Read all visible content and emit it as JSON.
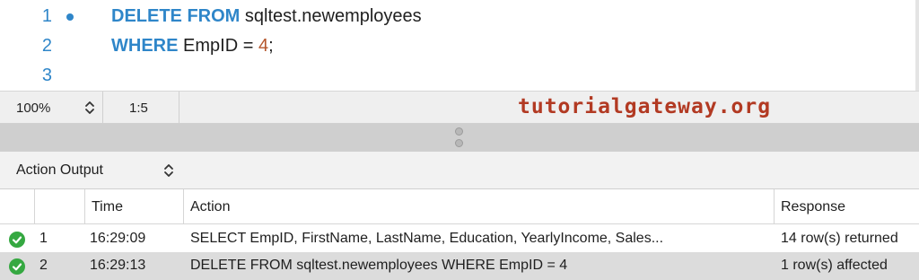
{
  "editor": {
    "lines": [
      {
        "number": "1",
        "keyword": "DELETE FROM",
        "rest": " sqltest.newemployees",
        "value": "",
        "tail": ""
      },
      {
        "number": "2",
        "keyword": "WHERE",
        "rest": " EmpID = ",
        "value": "4",
        "tail": ";"
      },
      {
        "number": "3",
        "keyword": "",
        "rest": "",
        "value": "",
        "tail": ""
      }
    ]
  },
  "statusbar": {
    "zoom": "100%",
    "cursor": "1:5",
    "watermark": "tutorialgateway.org"
  },
  "output": {
    "title": "Action Output",
    "columns": [
      "Time",
      "Action",
      "Response"
    ],
    "rows": [
      {
        "index": "1",
        "time": "16:29:09",
        "action": "SELECT EmpID, FirstName, LastName, Education,       YearlyIncome, Sales...",
        "response": "14 row(s) returned"
      },
      {
        "index": "2",
        "time": "16:29:13",
        "action": "DELETE FROM sqltest.newemployees WHERE EmpID = 4",
        "response": "1 row(s) affected"
      }
    ]
  },
  "colors": {
    "keyword": "#2f86c9",
    "number": "#b5562c",
    "watermark": "#b23a23",
    "success": "#35a841",
    "selected_row": "#dcdcdc"
  },
  "icons": [
    "breakpoint-dot-icon",
    "updown-chevron-icon",
    "splitter-grip-icon",
    "success-check-icon"
  ]
}
